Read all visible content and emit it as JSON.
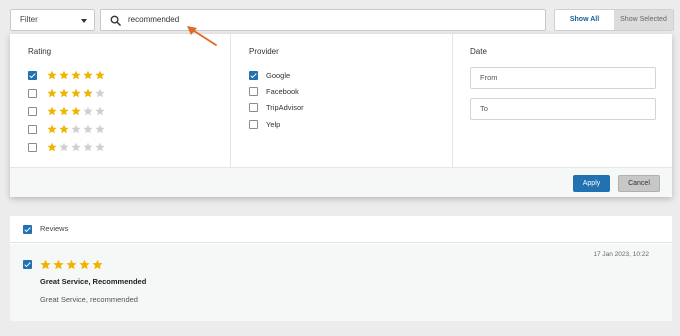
{
  "toolbar": {
    "filter_label": "Filter",
    "search_value": "recommended",
    "show_all": "Show All",
    "show_selected": "Show Selected"
  },
  "filters": {
    "rating": {
      "title": "Rating",
      "options": [
        {
          "stars": 5,
          "checked": true
        },
        {
          "stars": 4,
          "checked": false
        },
        {
          "stars": 3,
          "checked": false
        },
        {
          "stars": 2,
          "checked": false
        },
        {
          "stars": 1,
          "checked": false
        }
      ]
    },
    "provider": {
      "title": "Provider",
      "options": [
        {
          "label": "Google",
          "checked": true
        },
        {
          "label": "Facebook",
          "checked": false
        },
        {
          "label": "TripAdvisor",
          "checked": false
        },
        {
          "label": "Yelp",
          "checked": false
        }
      ]
    },
    "date": {
      "title": "Date",
      "from_placeholder": "From",
      "to_placeholder": "To"
    },
    "apply_label": "Apply",
    "cancel_label": "Cancel"
  },
  "reviews": {
    "header_label": "Reviews",
    "items": [
      {
        "rating": 5,
        "date": "17 Jan 2023, 10:22",
        "title": "Great Service, Recommended",
        "body": "Great Service, recommended"
      }
    ]
  },
  "colors": {
    "accent": "#2271b1",
    "star_on": "#f0b400",
    "star_off": "#d0d0d0",
    "arrow": "#e06a25"
  },
  "icons": {
    "search": "search-icon",
    "dropdown": "chevron-down-icon",
    "star": "star-icon",
    "annotation": "arrow-annotation-icon"
  }
}
